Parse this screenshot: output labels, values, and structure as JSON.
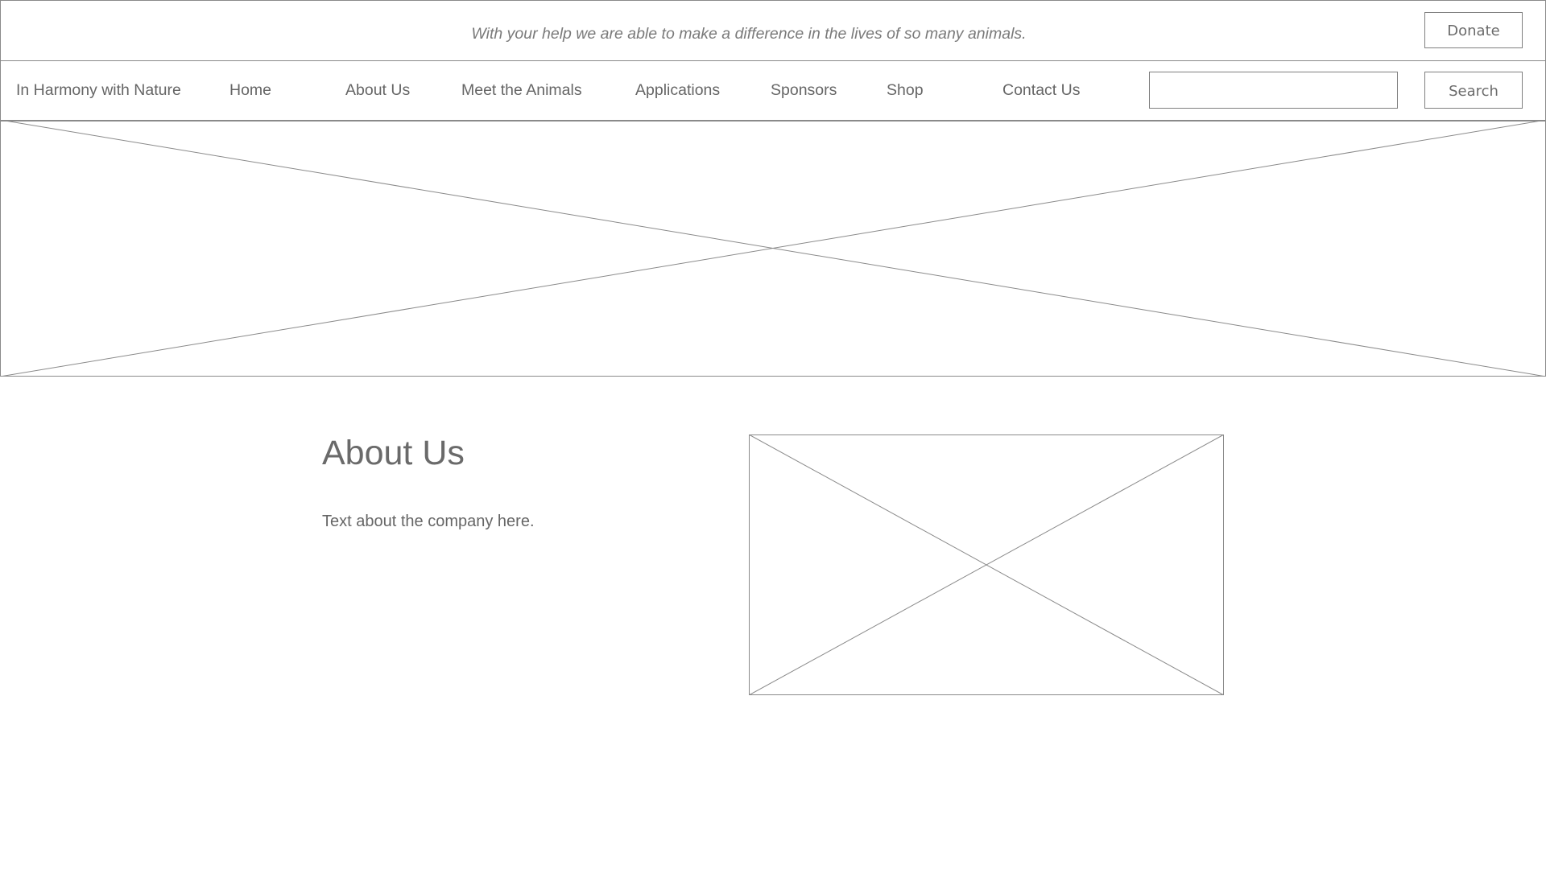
{
  "banner": {
    "tagline": "With your help we are able to make a difference in the lives of so many animals.",
    "donate_label": "Donate"
  },
  "nav": {
    "brand": "In Harmony with Nature",
    "items": [
      {
        "label": "Home"
      },
      {
        "label": "About Us"
      },
      {
        "label": "Meet the Animals"
      },
      {
        "label": "Applications"
      },
      {
        "label": "Sponsors"
      },
      {
        "label": "Shop"
      },
      {
        "label": "Contact Us"
      }
    ],
    "search": {
      "value": "",
      "placeholder": "",
      "button_label": "Search"
    }
  },
  "about": {
    "heading": "About Us",
    "body": "Text about the company here."
  },
  "colors": {
    "line": "#8a8a8a",
    "text": "#666666",
    "background": "#ffffff"
  },
  "icons": {
    "hero": "image-placeholder-icon",
    "about": "image-placeholder-icon"
  }
}
